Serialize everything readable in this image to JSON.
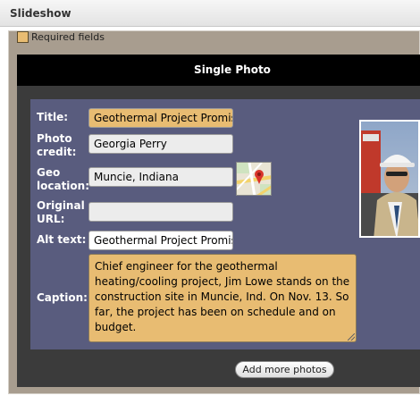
{
  "panel": {
    "title": "Slideshow"
  },
  "legend": {
    "required_label": "Required fields",
    "required_color": "#e8bc72"
  },
  "section": {
    "title": "Single Photo"
  },
  "form": {
    "title": {
      "label": "Title:",
      "value": "Geothermal Project Promise"
    },
    "photo_credit": {
      "label_line1": "Photo",
      "label_line2": "credit:",
      "value": "Georgia Perry"
    },
    "geo_location": {
      "label_line1": "Geo",
      "label_line2": "location:",
      "value": "Muncie, Indiana",
      "icon": "map-icon"
    },
    "original_url": {
      "label_line1": "Original",
      "label_line2": "URL:",
      "value": ""
    },
    "alt_text": {
      "label": "Alt text:",
      "value": "Geothermal Project Promise"
    },
    "caption": {
      "label": "Caption:",
      "value": "Chief engineer for the geothermal heating/cooling project, Jim Lowe stands on the construction site in Muncie, Ind. On Nov. 13. So far, the project has been on schedule and on budget."
    }
  },
  "buttons": {
    "add_more": "Add more photos"
  },
  "colors": {
    "frame": "#a89d8f",
    "dark": "#3b3b3b",
    "form_bg": "#595c7e",
    "required": "#e8bc72"
  }
}
